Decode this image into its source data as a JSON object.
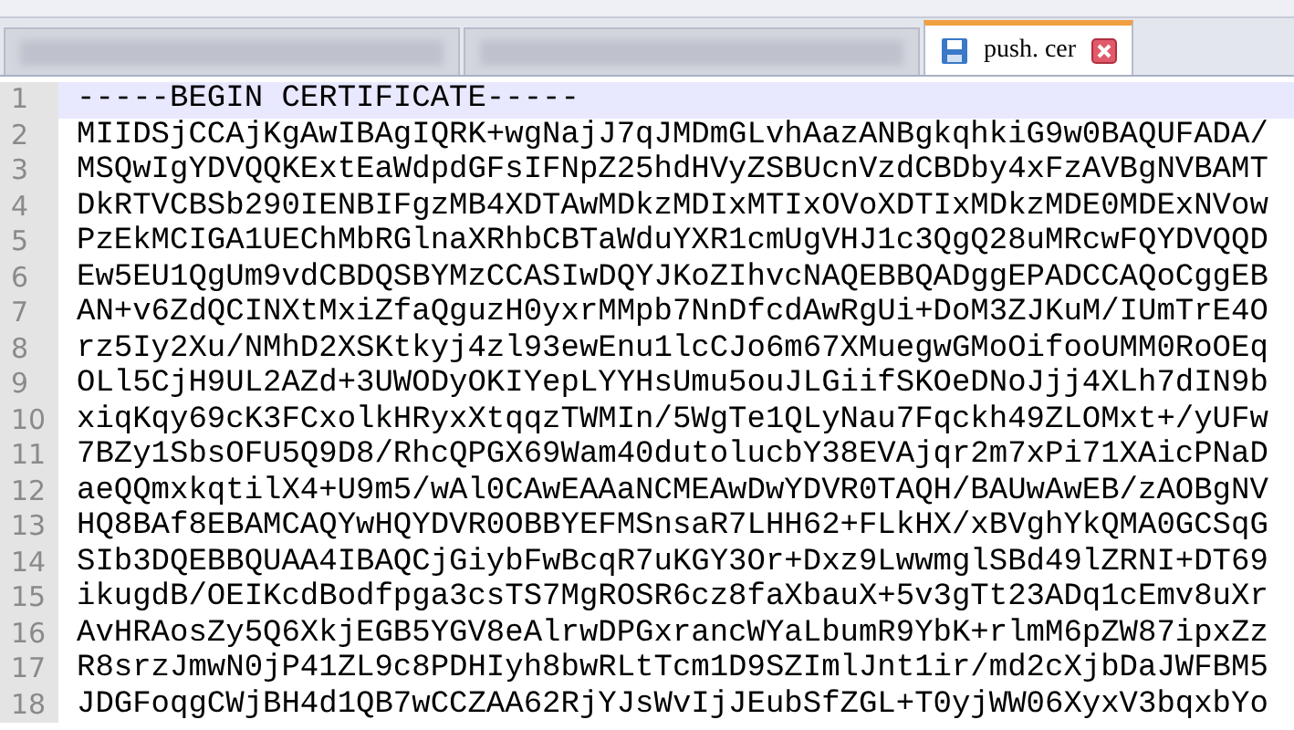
{
  "tabs": [
    {
      "blurred": true,
      "selected": false
    },
    {
      "blurred": true,
      "selected": false
    },
    {
      "label": "push. cer",
      "blurred": false,
      "selected": true
    }
  ],
  "lines": [
    {
      "number": "1",
      "text": "-----BEGIN CERTIFICATE-----",
      "current": true
    },
    {
      "number": "2",
      "text": "MIIDSjCCAjKgAwIBAgIQRK+wgNajJ7qJMDmGLvhAazANBgkqhkiG9w0BAQUFADA/",
      "current": false
    },
    {
      "number": "3",
      "text": "MSQwIgYDVQQKExtEaWdpdGFsIFNpZ25hdHVyZSBUcnVzdCBDby4xFzAVBgNVBAMT",
      "current": false
    },
    {
      "number": "4",
      "text": "DkRTVCBSb290IENBIFgzMB4XDTAwMDkzMDIxMTIxOVoXDTIxMDkzMDE0MDExNVow",
      "current": false
    },
    {
      "number": "5",
      "text": "PzEkMCIGA1UEChMbRGlnaXRhbCBTaWduYXR1cmUgVHJ1c3QgQ28uMRcwFQYDVQQD",
      "current": false
    },
    {
      "number": "6",
      "text": "Ew5EU1QgUm9vdCBDQSBYMzCCASIwDQYJKoZIhvcNAQEBBQADggEPADCCAQoCggEB",
      "current": false
    },
    {
      "number": "7",
      "text": "AN+v6ZdQCINXtMxiZfaQguzH0yxrMMpb7NnDfcdAwRgUi+DoM3ZJKuM/IUmTrE4O",
      "current": false
    },
    {
      "number": "8",
      "text": "rz5Iy2Xu/NMhD2XSKtkyj4zl93ewEnu1lcCJo6m67XMuegwGMoOifooUMM0RoOEq",
      "current": false
    },
    {
      "number": "9",
      "text": "OLl5CjH9UL2AZd+3UWODyOKIYepLYYHsUmu5ouJLGiifSKOeDNoJjj4XLh7dIN9b",
      "current": false
    },
    {
      "number": "10",
      "text": "xiqKqy69cK3FCxolkHRyxXtqqzTWMIn/5WgTe1QLyNau7Fqckh49ZLOMxt+/yUFw",
      "current": false
    },
    {
      "number": "11",
      "text": "7BZy1SbsOFU5Q9D8/RhcQPGX69Wam40dutolucbY38EVAjqr2m7xPi71XAicPNaD",
      "current": false
    },
    {
      "number": "12",
      "text": "aeQQmxkqtilX4+U9m5/wAl0CAwEAAaNCMEAwDwYDVR0TAQH/BAUwAwEB/zAOBgNV",
      "current": false
    },
    {
      "number": "13",
      "text": "HQ8BAf8EBAMCAQYwHQYDVR0OBBYEFMSnsaR7LHH62+FLkHX/xBVghYkQMA0GCSqG",
      "current": false
    },
    {
      "number": "14",
      "text": "SIb3DQEBBQUAA4IBAQCjGiybFwBcqR7uKGY3Or+Dxz9LwwmglSBd49lZRNI+DT69",
      "current": false
    },
    {
      "number": "15",
      "text": "ikugdB/OEIKcdBodfpga3csTS7MgROSR6cz8faXbauX+5v3gTt23ADq1cEmv8uXr",
      "current": false
    },
    {
      "number": "16",
      "text": "AvHRAosZy5Q6XkjEGB5YGV8eAlrwDPGxrancWYaLbumR9YbK+rlmM6pZW87ipxZz",
      "current": false
    },
    {
      "number": "17",
      "text": "R8srzJmwN0jP41ZL9c8PDHIyh8bwRLtTcm1D9SZImlJnt1ir/md2cXjbDaJWFBM5",
      "current": false
    },
    {
      "number": "18",
      "text": "JDGFoqgCWjBH4d1QB7wCCZAA62RjYJsWvIjJEubSfZGL+T0yjWW06XyxV3bqxbYo",
      "current": false
    }
  ]
}
